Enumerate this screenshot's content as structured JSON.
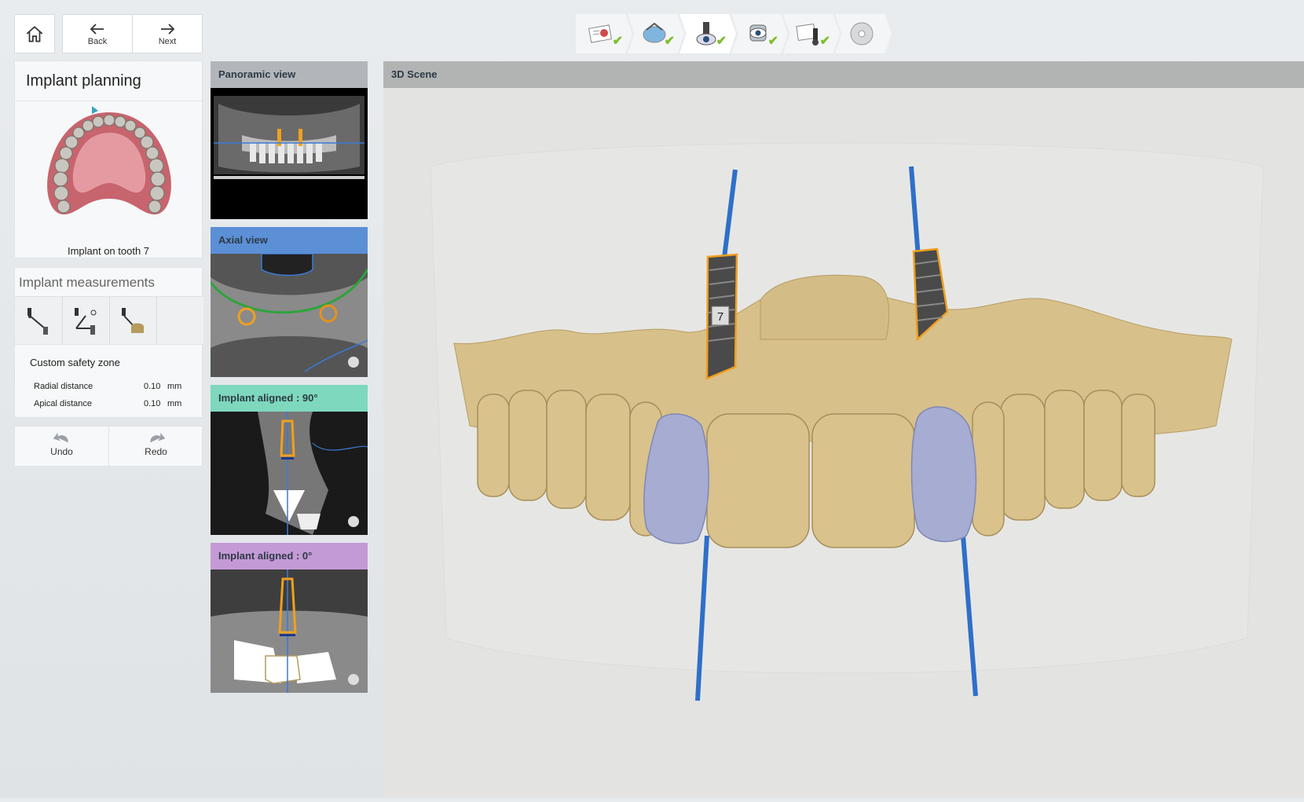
{
  "nav": {
    "home_icon": "home-icon",
    "back_label": "Back",
    "next_label": "Next"
  },
  "workflow": {
    "steps": [
      {
        "icon": "patient-card-icon",
        "done": true
      },
      {
        "icon": "scan-import-icon",
        "done": true
      },
      {
        "icon": "implant-eye-icon",
        "done": true,
        "active": true
      },
      {
        "icon": "sleeve-view-icon",
        "done": true
      },
      {
        "icon": "guide-design-icon",
        "done": true
      },
      {
        "icon": "export-disc-icon",
        "done": false
      }
    ],
    "check_glyph": "✔"
  },
  "planning": {
    "title": "Implant planning",
    "tooth_caption": "Implant on tooth 7"
  },
  "measurements": {
    "title": "Implant measurements",
    "tools": [
      "distance-measure-icon",
      "angle-measure-icon",
      "volume-measure-icon"
    ],
    "safety_zone_label": "Custom safety zone",
    "radial_label": "Radial distance",
    "radial_value": "0.10",
    "radial_unit": "mm",
    "apical_label": "Apical distance",
    "apical_value": "0.10",
    "apical_unit": "mm"
  },
  "history": {
    "undo_label": "Undo",
    "redo_label": "Redo"
  },
  "views": {
    "panoramic": {
      "title": "Panoramic view",
      "color": "#b2b6ba"
    },
    "axial": {
      "title": "Axial view",
      "color": "#5b8fd6"
    },
    "aligned90": {
      "title": "Implant aligned : 90°",
      "color": "#7ed8bd"
    },
    "aligned0": {
      "title": "Implant aligned : 0°",
      "color": "#c49ad6"
    }
  },
  "scene": {
    "title": "3D Scene",
    "implant_label": "7"
  },
  "colors": {
    "accent_blue": "#2f6fc9",
    "implant_orange": "#f0a020",
    "gum_model": "#d8c08a",
    "crown_blue": "#a6acd2",
    "check_green": "#7cbf2a"
  }
}
